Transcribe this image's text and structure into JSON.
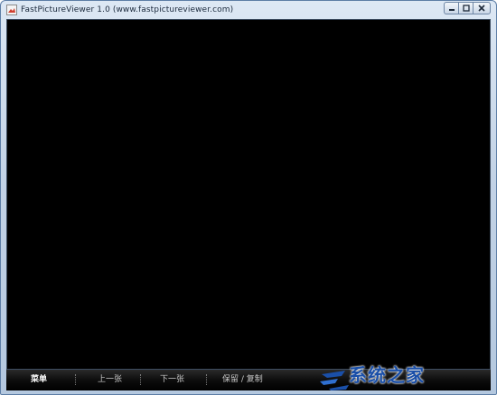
{
  "window": {
    "title": "FastPictureViewer 1.0 (www.fastpictureviewer.com)"
  },
  "controls": {
    "minimize_icon": "minimize-icon",
    "maximize_icon": "maximize-icon",
    "close_icon": "close-icon"
  },
  "toolbar": {
    "items": [
      {
        "label": "菜单",
        "active": true
      },
      {
        "label": "上一张"
      },
      {
        "label": "下一张"
      },
      {
        "label": "保留 / 复制"
      }
    ]
  },
  "watermark": {
    "text": "系统之家"
  },
  "colors": {
    "viewport_bg": "#000000",
    "titlebar": "#c3d3e6",
    "watermark": "#1a4fa8"
  }
}
